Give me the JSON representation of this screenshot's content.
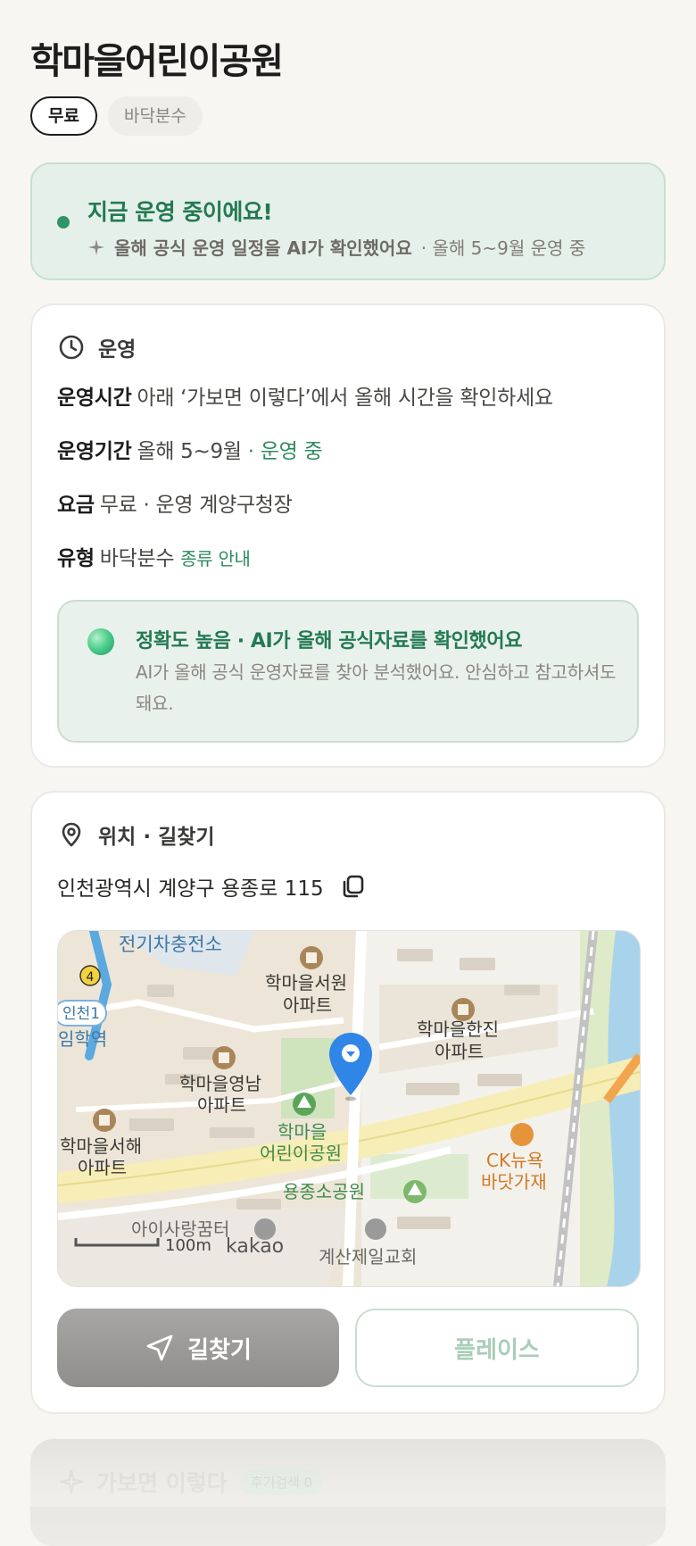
{
  "header": {
    "title": "학마을어린이공원",
    "chips": [
      "무료",
      "바닥분수"
    ]
  },
  "status": {
    "title": "지금 운영 중이에요!",
    "note": "올해 공식 운영 일정을 AI가 확인했어요",
    "period": "· 올해 5~9월 운영 중",
    "accent_color": "#2f9466"
  },
  "operation": {
    "heading": "운영",
    "rows": [
      {
        "key": "운영시간",
        "value": "아래 ‘가보면 이렇다’에서 올해 시간을 확인하세요",
        "extra": ""
      },
      {
        "key": "운영기간",
        "value": "올해 5~9월",
        "extra": "· 운영 중"
      },
      {
        "key": "요금",
        "value": "무료 · 운영 계양구청장",
        "extra": ""
      },
      {
        "key": "유형",
        "value": "바닥분수",
        "extra": "종류 안내"
      }
    ],
    "ai": {
      "title": "정확도 높음 · AI가 올해 공식자료를 확인했어요",
      "desc": "AI가 올해 공식 운영자료를 찾아 분석했어요. 안심하고 참고하셔도 돼요."
    }
  },
  "location": {
    "heading": "위치 · 길찾기",
    "address": "인천광역시 계양구 용종로 115",
    "map": {
      "labels": {
        "ev": "전기차충전소",
        "apt_seowon_1": "학마을서원",
        "apt_seowon_2": "아파트",
        "apt_hanjin_1": "학마을한진",
        "apt_hanjin_2": "아파트",
        "apt_yeongnam_1": "학마을영남",
        "apt_yeongnam_2": "아파트",
        "apt_seohae_1": "학마을서해",
        "apt_seohae_2": "아파트",
        "park_1": "학마을",
        "park_2": "어린이공원",
        "ck_1": "CK뉴욕",
        "ck_2": "바닷가재",
        "yongjong": "용종소공원",
        "aisarang": "아이사랑꿈터",
        "church": "계산제일교회",
        "station_badge": "인천1",
        "station": "임학역",
        "line_num": "4",
        "scale": "100m",
        "brand": "kakao"
      }
    },
    "buttons": {
      "route": "길찾기",
      "place": "플레이스"
    }
  },
  "next_section": {
    "heading": "가보면 이렇다",
    "badge": "후기검색 0"
  }
}
